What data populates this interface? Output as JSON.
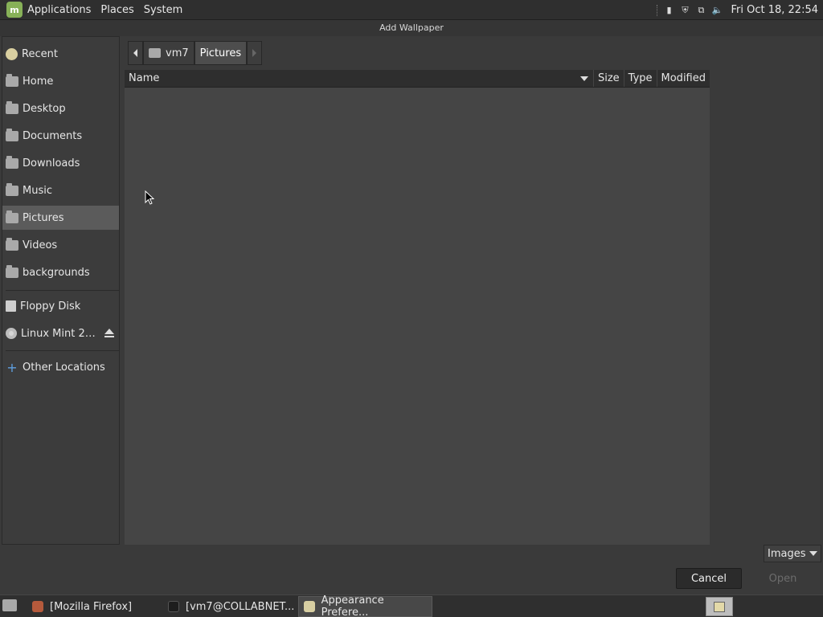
{
  "top_panel": {
    "menus": [
      "Applications",
      "Places",
      "System"
    ],
    "clock": "Fri Oct 18, 22:54",
    "tray_icons": [
      "battery-icon",
      "shield-icon",
      "network-icon",
      "volume-icon"
    ]
  },
  "dialog": {
    "title": "Add Wallpaper"
  },
  "sidebar": {
    "items": [
      {
        "label": "Recent",
        "icon": "recent-icon"
      },
      {
        "label": "Home",
        "icon": "home-folder-icon"
      },
      {
        "label": "Desktop",
        "icon": "desktop-folder-icon"
      },
      {
        "label": "Documents",
        "icon": "documents-folder-icon"
      },
      {
        "label": "Downloads",
        "icon": "downloads-folder-icon"
      },
      {
        "label": "Music",
        "icon": "music-folder-icon"
      },
      {
        "label": "Pictures",
        "icon": "pictures-folder-icon",
        "selected": true
      },
      {
        "label": "Videos",
        "icon": "videos-folder-icon"
      },
      {
        "label": "backgrounds",
        "icon": "folder-icon"
      }
    ],
    "devices": [
      {
        "label": "Floppy Disk",
        "icon": "floppy-icon"
      },
      {
        "label": "Linux Mint 2…",
        "icon": "disc-icon"
      }
    ],
    "other": {
      "label": "Other Locations",
      "icon": "plus-icon"
    }
  },
  "pathbar": {
    "segments": [
      "vm7",
      "Pictures"
    ]
  },
  "file_list": {
    "columns": [
      "Name",
      "Size",
      "Type",
      "Modified"
    ]
  },
  "filter": {
    "selected": "Images"
  },
  "buttons": {
    "cancel": "Cancel",
    "open": "Open"
  },
  "taskbar": {
    "tasks": [
      "[Mozilla Firefox]",
      "[vm7@COLLABNET...",
      "Appearance Prefere..."
    ]
  }
}
